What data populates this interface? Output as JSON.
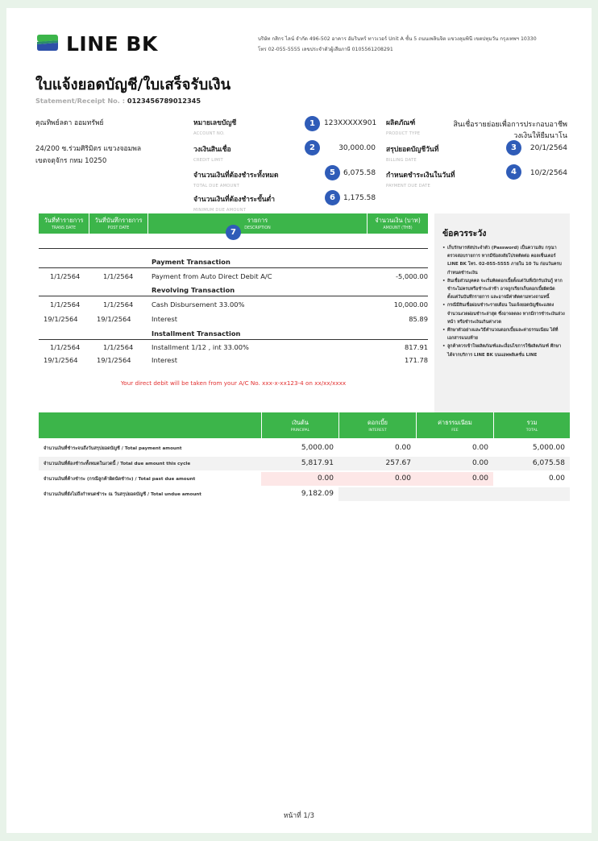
{
  "brand": {
    "name": "LINE BK"
  },
  "company": {
    "line1": "บริษัท กสิกร ไลน์ จำกัด 496-502 อาคาร อัมรินทร์ ทาวเวอร์ Unit A ชั้น 5 ถนนเพลินจิต แขวงลุมพินี เขตปทุมวัน กรุงเทพฯ 10330",
    "line2": "โทร 02-055-5555 เลขประจำตัวผู้เสียภาษี 0105561208291"
  },
  "title": "ใบแจ้งยอดบัญชี/ใบเสร็จรับเงิน",
  "statement_label": "Statement/Receipt No. :",
  "statement_no": "0123456789012345",
  "customer": {
    "name": "คุณทิพย์ลดา ออมทรัพย์",
    "address1": "24/200 ซ.ร่วมศิริมิตร แขวงจอมพล",
    "address2": "เขตจตุจักร กทม 10250"
  },
  "fields": {
    "account_no": {
      "label": "หมายเลขบัญชี",
      "sub": "ACCOUNT NO.",
      "badge": "1",
      "value": "123XXXXX901"
    },
    "credit_limit": {
      "label": "วงเงินสินเชื่อ",
      "sub": "CREDIT LIMIT",
      "badge": "2",
      "value": "30,000.00"
    },
    "total_due": {
      "label": "จำนวนเงินที่ต้องชำระทั้งหมด",
      "sub": "TOTAL DUE AMOUNT",
      "badge": "5",
      "value": "6,075.58"
    },
    "minimum_due": {
      "label": "จำนวนเงินที่ต้องชำระขั้นต่ำ",
      "sub": "MINIMUM DUE AMOUNT",
      "badge": "6",
      "value": "1,175.58"
    },
    "product_type": {
      "label": "ผลิตภัณฑ์",
      "sub": "PRODUCT TYPE",
      "value1": "สินเชื่อรายย่อยเพื่อการประกอบอาชีพ",
      "value2": "วงเงินให้ยืมนาโน"
    },
    "billing_date": {
      "label": "สรุปยอดบัญชีวันที่",
      "sub": "BILLING DATE",
      "badge": "3",
      "value": "20/1/2564"
    },
    "payment_due": {
      "label": "กำหนดชำระเงินในวันที่",
      "sub": "PAYMENT DUE DATE",
      "badge": "4",
      "value": "10/2/2564"
    }
  },
  "table": {
    "headers": [
      {
        "th": "วันที่ทำรายการ",
        "en": "TRANS DATE"
      },
      {
        "th": "วันที่บันทึกรายการ",
        "en": "POST DATE"
      },
      {
        "th": "รายการ",
        "en": "DESCRIPTION",
        "badge": "7"
      },
      {
        "th": "จำนวนเงิน (บาท)",
        "en": "AMOUNT (THB)"
      }
    ],
    "sections": {
      "payment": "Payment Transaction",
      "revolving": "Revolving Transaction",
      "installment": "Installment Transaction"
    },
    "rows": [
      {
        "trans": "1/1/2564",
        "post": "1/1/2564",
        "desc": "Payment from Auto Direct Debit A/C",
        "amount": "-5,000.00"
      },
      {
        "trans": "1/1/2564",
        "post": "1/1/2564",
        "desc": "Cash Disbursement 33.00%",
        "amount": "10,000.00"
      },
      {
        "trans": "19/1/2564",
        "post": "19/1/2564",
        "desc": "Interest",
        "amount": "85.89"
      },
      {
        "trans": "1/1/2564",
        "post": "1/1/2564",
        "desc": "Installment  1/12 , int 33.00%",
        "amount": "817.91"
      },
      {
        "trans": "19/1/2564",
        "post": "19/1/2564",
        "desc": "Interest",
        "amount": "171.78"
      }
    ],
    "debit_note": "Your direct debit will be taken from your A/C No. xxx-x-xx123-4 on xx/xx/xxxx"
  },
  "notice": {
    "title": "ข้อควรระวัง",
    "items": [
      "เก็บรักษารหัสประจำตัว (Password) เป็นความลับ กรุณาตรวจสอบรายการ หากมีข้อสงสัยโปรดติดต่อ คอลเซ็นเตอร์ LINE BK โทร. 02-055-5555 ภายใน 10 วัน ก่อนวันครบกำหนดชำระเงิน",
      "สินเชื่อส่วนบุคคล จะเริ่มคิดดอกเบี้ยตั้งแต่วันที่เบิกรับเงินกู้ หากชำระไม่ครบหรือชำระล่าช้า อาจถูกเรียกเก็บดอกเบี้ยผิดนัดตั้งแต่วันบันทึกรายการ และอาจมีค่าติดตามทวงถามหนี้",
      "กรณีมีสินเชื่อผ่อนชำระรายเดือน ในแจ้งยอดบัญชีจะแสดงจำนวนงวดผ่อนชำระล่าสุด ซึ่งอาจลดลง หากมีการชำระเงินล่วงหน้า หรือชำระเงินเกินค่างวด",
      "ศึกษาตัวอย่างและวิธีคำนวณดอกเบี้ยและค่าธรรมเนียม ได้ที่เอกสารแนบท้าย",
      "ลูกค้าควรเข้าใจผลิตภัณฑ์และเงื่อนไขการใช้ผลิตภัณฑ์ ศึกษาได้จากบริการ LINE BK บนแอพพลิเคชั่น LINE"
    ]
  },
  "summary": {
    "headers": [
      {
        "th": "เงินต้น",
        "en": "PRINCIPAL"
      },
      {
        "th": "ดอกเบี้ย",
        "en": "INTEREST"
      },
      {
        "th": "ค่าธรรมเนียม",
        "en": "FEE"
      },
      {
        "th": "รวม",
        "en": "TOTAL"
      }
    ],
    "rows": [
      {
        "label": "จำนวนเงินที่ชำระจนถึงวันสรุปยอดบัญชี / Total payment amount",
        "principal": "5,000.00",
        "interest": "0.00",
        "fee": "0.00",
        "total": "5,000.00"
      },
      {
        "label": "จำนวนเงินที่ต้องชำระทั้งหมดในงวดนี้ / Total due amount this cycle",
        "principal": "5,817.91",
        "interest": "257.67",
        "fee": "0.00",
        "total": "6,075.58"
      },
      {
        "label": "จำนวนเงินที่ค้างชำระ (กรณีลูกค้าผิดนัดชำระ) / Total past due amount",
        "principal": "0.00",
        "interest": "0.00",
        "fee": "0.00",
        "total": "0.00"
      },
      {
        "label": "จำนวนเงินที่ยังไม่ถึงกำหนดชำระ ณ วันสรุปยอดบัญชี / Total undue amount",
        "principal": "9,182.09"
      }
    ]
  },
  "page": "หน้าที่ 1/3",
  "colors": {
    "green": "#3cb54a",
    "badge": "#2f5cb8",
    "warning_text": "#e23030",
    "past_due_bg": "#fde7e7"
  }
}
